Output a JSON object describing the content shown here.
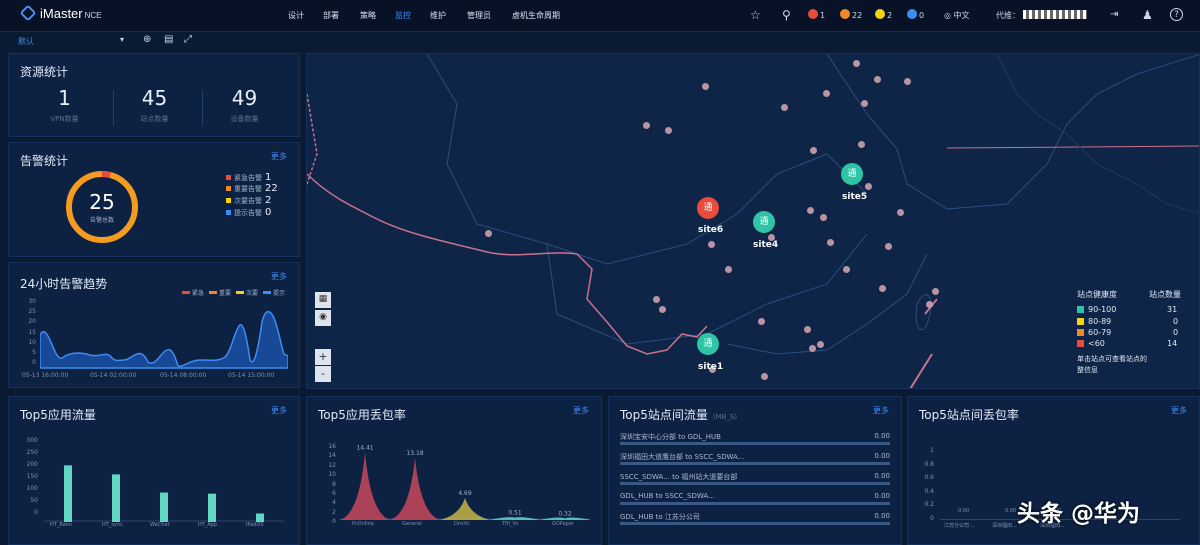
{
  "topbar": {
    "logo": "iMaster",
    "logo_sub": "NCE",
    "nav": [
      "设计",
      "部署",
      "策略",
      "监控",
      "维护",
      "管理员",
      "虚机生命周期"
    ],
    "active_nav_index": 3,
    "alarm_counts": [
      {
        "color": "#e84c3d",
        "count": "1"
      },
      {
        "color": "#f08a24",
        "count": "22"
      },
      {
        "color": "#f5d312",
        "count": "2"
      },
      {
        "color": "#3d8df5",
        "count": "0"
      }
    ],
    "lang": "中文",
    "user_label": "代维："
  },
  "subbar": {
    "selector": "默认"
  },
  "resource": {
    "title": "资源统计",
    "stats": [
      {
        "value": "1",
        "label": "VPN数量"
      },
      {
        "value": "45",
        "label": "站点数量"
      },
      {
        "value": "49",
        "label": "设备数量"
      }
    ]
  },
  "alarm_stat": {
    "title": "告警统计",
    "more": "更多",
    "total": "25",
    "total_label": "告警总数",
    "items": [
      {
        "label": "紧急告警",
        "value": "1",
        "color": "#e84c3d"
      },
      {
        "label": "重要告警",
        "value": "22",
        "color": "#f08a24"
      },
      {
        "label": "次要告警",
        "value": "2",
        "color": "#f5d312"
      },
      {
        "label": "提示告警",
        "value": "0",
        "color": "#3d8df5"
      }
    ]
  },
  "trend": {
    "title": "24小时告警趋势",
    "more": "更多",
    "legend": [
      {
        "label": "紧急",
        "color": "#e84c3d"
      },
      {
        "label": "重要",
        "color": "#f08a24"
      },
      {
        "label": "次要",
        "color": "#f5d312"
      },
      {
        "label": "提示",
        "color": "#3d8df5"
      }
    ],
    "yticks": [
      "30",
      "25",
      "20",
      "15",
      "10",
      "5",
      "0"
    ],
    "xticks": [
      "05-13 16:00:00",
      "05-14 02:00:00",
      "05-14 08:00:00",
      "05-14 15:00:00"
    ]
  },
  "map": {
    "sites": [
      "site1",
      "site4",
      "site5",
      "site6"
    ],
    "pin_char": "通",
    "zoom_in": "+",
    "zoom_out": "-",
    "legend_h1": "站点健康度",
    "legend_h2": "站点数量",
    "legend_rows": [
      {
        "range": "90-100",
        "count": "31",
        "color": "#2ec4a6"
      },
      {
        "range": "80-89",
        "count": "0",
        "color": "#f5d312"
      },
      {
        "range": "60-79",
        "count": "0",
        "color": "#f08a24"
      },
      {
        "range": "<60",
        "count": "14",
        "color": "#e84c3d"
      }
    ],
    "legend_note_1": "单击站点可查看站点的",
    "legend_note_2": "整信息"
  },
  "chart_data": [
    {
      "type": "bar",
      "title": "Top5应用流量",
      "categories": [
        "HT_Bann",
        "HT_sync",
        "WeChat",
        "HT_App",
        "iPadOS"
      ],
      "values": [
        200,
        168,
        104,
        100,
        30
      ],
      "ylim": [
        0,
        300
      ],
      "yticks": [
        "300",
        "250",
        "200",
        "150",
        "100",
        "50",
        "0"
      ],
      "colors": [
        "#5fd7c2"
      ]
    },
    {
      "type": "area",
      "title": "Top5应用丢包率",
      "categories": [
        "PcOnline",
        "General",
        "DnsVc",
        "Tftl_Vc",
        "GOPaper"
      ],
      "values": [
        14.41,
        13.18,
        4.69,
        0.51,
        0.32
      ],
      "value_labels": [
        "14.41",
        "13.18",
        "4.69",
        "0.51",
        "0.32"
      ],
      "ylim": [
        0,
        16
      ],
      "yticks": [
        "16",
        "14",
        "12",
        "10",
        "8",
        "6",
        "4",
        "2",
        "0"
      ],
      "colors": [
        "#c9485b",
        "#c9485b",
        "#c5b545",
        "#5fd7c2",
        "#5fd7c2"
      ]
    }
  ],
  "top5_site_flow": {
    "title": "Top5站点间流量",
    "unit": "(MB_S)",
    "more": "更多",
    "rows": [
      {
        "label": "深圳宝安中心分部 to GDL_HUB",
        "value": "0.00"
      },
      {
        "label": "深圳福田大道鹰台部 to SSCC_SDWA...",
        "value": "0.00"
      },
      {
        "label": "SSCC_SDWA... to 福州站大道要台部",
        "value": "0.00"
      },
      {
        "label": "GDL_HUB to SSCC_SDWA...",
        "value": "0.00"
      },
      {
        "label": "GDL_HUB to 江苏分公司",
        "value": "0.00"
      }
    ]
  },
  "top5_site_loss": {
    "title": "Top5站点间丢包率",
    "more": "更多",
    "yticks": [
      "1",
      "0.8",
      "0.6",
      "0.4",
      "0.2",
      "0"
    ],
    "values": [
      "0.00",
      "0.00",
      "0.00"
    ],
    "xlabels": [
      "江苏分公司 ...",
      "深圳福田...",
      "深圳福田..."
    ]
  },
  "watermark": "头条 @华为"
}
